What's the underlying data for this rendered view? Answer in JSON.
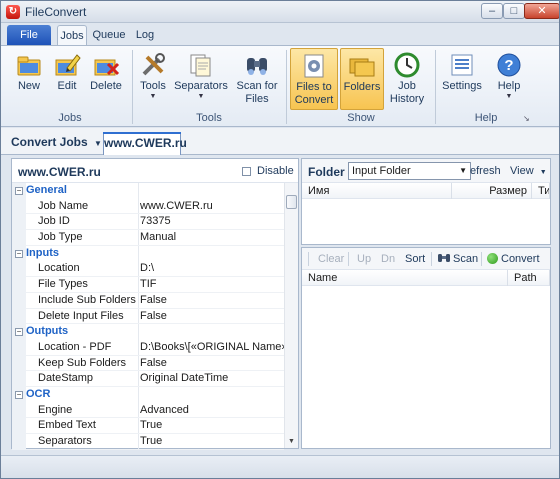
{
  "window": {
    "title": "FileConvert",
    "minimize": "–",
    "maximize": "□",
    "close": "✕"
  },
  "ribbon_tabs": {
    "file": "File",
    "jobs": "Jobs",
    "queue": "Queue",
    "log": "Log"
  },
  "ribbon": {
    "new": "New",
    "edit": "Edit",
    "delete": "Delete",
    "tools": "Tools",
    "separators": "Separators",
    "scan_for_files": [
      "Scan for",
      "Files"
    ],
    "files_to_convert": [
      "Files to",
      "Convert"
    ],
    "folders": "Folders",
    "job_history": [
      "Job",
      "History"
    ],
    "settings": "Settings",
    "help": "Help",
    "groups": {
      "jobs": "Jobs",
      "tools": "Tools",
      "show": "Show",
      "help": "Help"
    }
  },
  "docbar": {
    "convert_jobs": "Convert Jobs",
    "active_tab": "www.CWER.ru"
  },
  "job_panel": {
    "title": "www.CWER.ru",
    "disable_label": "Disable",
    "rows": [
      {
        "type": "cat",
        "name": "General"
      },
      {
        "name": "Job Name",
        "value": "www.CWER.ru"
      },
      {
        "name": "Job ID",
        "value": "73375"
      },
      {
        "name": "Job Type",
        "value": "Manual"
      },
      {
        "type": "cat",
        "name": "Inputs"
      },
      {
        "name": "Location",
        "value": "D:\\"
      },
      {
        "name": "File Types",
        "value": "TIF"
      },
      {
        "name": "Include Sub Folders",
        "value": "False"
      },
      {
        "name": "Delete Input Files",
        "value": "False"
      },
      {
        "type": "cat",
        "name": "Outputs"
      },
      {
        "name": "Location - PDF",
        "value": "D:\\Books\\[«ORIGINAL Name»].PI"
      },
      {
        "name": "Keep Sub Folders",
        "value": "False"
      },
      {
        "name": "DateStamp",
        "value": "Original DateTime"
      },
      {
        "type": "cat",
        "name": "OCR"
      },
      {
        "name": "Engine",
        "value": "Advanced"
      },
      {
        "name": "Embed Text",
        "value": "True"
      },
      {
        "name": "Separators",
        "value": "True"
      }
    ]
  },
  "folder_panel": {
    "title": "Folder",
    "select_value": "Input Folder",
    "refresh": "efresh",
    "view": "View",
    "columns": {
      "name": "Имя",
      "size": "Размер",
      "type": "Ти"
    }
  },
  "files_panel": {
    "toolbar": {
      "clear": "Clear",
      "up": "Up",
      "dn": "Dn",
      "sort": "Sort",
      "scan": "Scan",
      "convert": "Convert"
    },
    "columns": {
      "name": "Name",
      "path": "Path"
    }
  },
  "colors": {
    "accent": "#1f63c6",
    "file_tab": "#1e52b8",
    "selected": "#f7c451"
  }
}
